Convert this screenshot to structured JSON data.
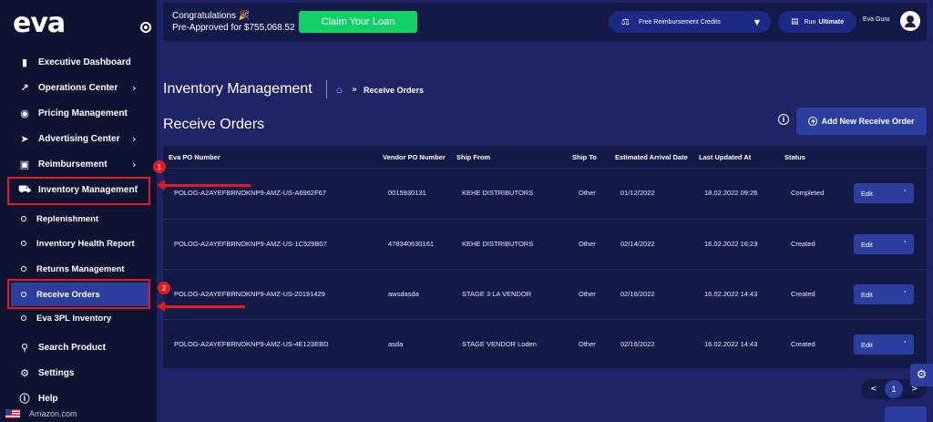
{
  "brand": {
    "logo": "eva"
  },
  "sidebar": {
    "items": [
      {
        "label": "Executive Dashboard",
        "icon": "bar-chart-icon"
      },
      {
        "label": "Operations Center",
        "icon": "trend-icon"
      },
      {
        "label": "Pricing Management",
        "icon": "award-icon"
      },
      {
        "label": "Advertising Center",
        "icon": "rocket-icon"
      },
      {
        "label": "Reimbursement",
        "icon": "wallet-icon"
      },
      {
        "label": "Inventory Management",
        "icon": "truck-icon"
      }
    ],
    "subitems": [
      {
        "label": "Replenishment"
      },
      {
        "label": "Inventory Health Report"
      },
      {
        "label": "Returns Management"
      },
      {
        "label": "Receive Orders"
      },
      {
        "label": "Eva 3PL Inventory"
      }
    ],
    "bottom": [
      {
        "label": "Search Product",
        "icon": "search-icon"
      },
      {
        "label": "Settings",
        "icon": "gear-icon"
      },
      {
        "label": "Help",
        "icon": "help-icon"
      }
    ],
    "marketplace": "Amazon.com"
  },
  "topbar": {
    "congrats_line1": "Congratulations",
    "congrats_line2": "Pre-Approved for $755,068.52",
    "claim_label": "Claim Your Loan",
    "credits_label": "Free Reimbursement Credits",
    "plan_prefix": "Run",
    "plan_name": "Ultimate",
    "user_name": "Eva Guru"
  },
  "breadcrumb": {
    "module": "Inventory Management",
    "current": "Receive Orders"
  },
  "section": {
    "title": "Receive Orders",
    "add_label": "Add New Receive Order"
  },
  "table": {
    "headers": [
      "Eva PO Number",
      "Vendor PO Number",
      "Ship From",
      "Ship To",
      "Estimated Arrival Date",
      "Last Updated At",
      "Status"
    ],
    "rows": [
      [
        "POLOG-A2AYEFBRNOKNP9-AMZ-US-A6962F67",
        "0015930131",
        "KEHE DISTRIBUTORS",
        "Other",
        "01/12/2022",
        "18.02.2022 09:26",
        "Completed"
      ],
      [
        "POLOG-A2AYEFBRNOKNP9-AMZ-US-1C529B07",
        "478340630161",
        "KEHE DISTRIBUTORS",
        "Other",
        "02/14/2022",
        "16.02.2022 16:23",
        "Created"
      ],
      [
        "POLOG-A2AYEFBRNOKNP9-AMZ-US-20191429",
        "awsdasda",
        "STAGE 3 LA VENDOR",
        "Other",
        "02/16/2022",
        "16.02.2022 14:43",
        "Created"
      ],
      [
        "POLOG-A2AYEFBRNOKNP9-AMZ-US-4E123EBD",
        "asda",
        "STAGE VENDOR Loden",
        "Other",
        "02/16/2022",
        "16.02.2022 14:43",
        "Created"
      ]
    ],
    "action_label": "Edit"
  },
  "annotations": {
    "badge1": "1",
    "badge2": "2"
  },
  "pagination": {
    "current": "1",
    "prev": "<",
    "next": ">"
  },
  "colors": {
    "accent": "#2c3f9e",
    "highlight": "#e01b24",
    "claim": "#13cf6a",
    "sidebar": "#0d1330",
    "content": "#1f2466"
  }
}
